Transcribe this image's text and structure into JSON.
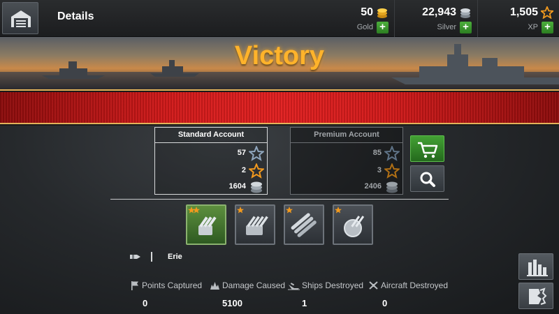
{
  "header": {
    "title": "Details",
    "gold": {
      "value": "50",
      "label": "Gold"
    },
    "silver": {
      "value": "22,943",
      "label": "Silver"
    },
    "xp": {
      "value": "1,505",
      "label": "XP"
    }
  },
  "banner": {
    "result": "Victory"
  },
  "standard_account": {
    "title": "Standard Account",
    "stars_blue": "57",
    "stars_orange": "2",
    "silver": "1604"
  },
  "premium_account": {
    "title": "Premium Account",
    "stars_blue": "85",
    "stars_orange": "3",
    "silver": "2406"
  },
  "medals": [
    {
      "icon": "triple-turret-medal-icon",
      "stars": 2,
      "highlighted": true
    },
    {
      "icon": "quad-turret-medal-icon",
      "stars": 1,
      "highlighted": false
    },
    {
      "icon": "torpedo-launcher-medal-icon",
      "stars": 1,
      "highlighted": false
    },
    {
      "icon": "aa-gun-medal-icon",
      "stars": 1,
      "highlighted": false
    }
  ],
  "player": {
    "name": "Erie"
  },
  "stats": {
    "points_captured": {
      "label": "Points Captured",
      "value": "0"
    },
    "damage_caused": {
      "label": "Damage Caused",
      "value": "5100"
    },
    "ships_destroyed": {
      "label": "Ships Destroyed",
      "value": "1"
    },
    "aircraft_destroyed": {
      "label": "Aircraft Destroyed",
      "value": "0"
    }
  },
  "colors": {
    "accent_gold": "#ffb32b",
    "banner_red": "#d21a1a",
    "button_green": "#43a134",
    "star_orange": "#f39a1e",
    "star_blue": "#8fa6bd"
  }
}
